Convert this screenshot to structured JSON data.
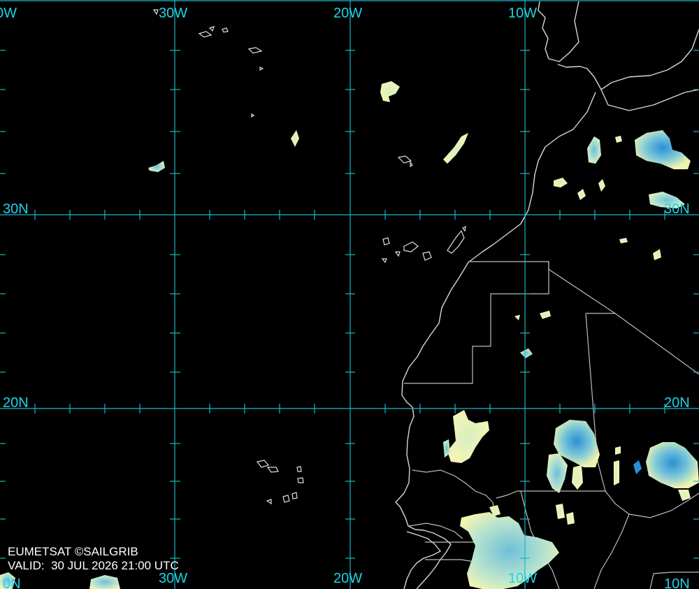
{
  "lon_labels_top": [
    "0W",
    "30W",
    "20W",
    "10W"
  ],
  "lon_labels_bottom": [
    "30W",
    "20W",
    "10W"
  ],
  "lat_labels": {
    "30N_left": "30N",
    "30N_right": "30N",
    "20N_left": "20N",
    "20N_right": "20N",
    "10N_left": "0N",
    "10N_right": "10N"
  },
  "credit": "EUMETSAT ©SAILGRIB",
  "valid": "VALID:  30 JUL 2026 21:00 UTC",
  "colors": {
    "grid": "#17b7c9",
    "label": "#1fd3e6",
    "coast": "#d8d8d8",
    "cloud_light": "#f4f5b0",
    "cloud_mid": "#8fd4d6",
    "cloud_dark": "#2a8fd6"
  }
}
